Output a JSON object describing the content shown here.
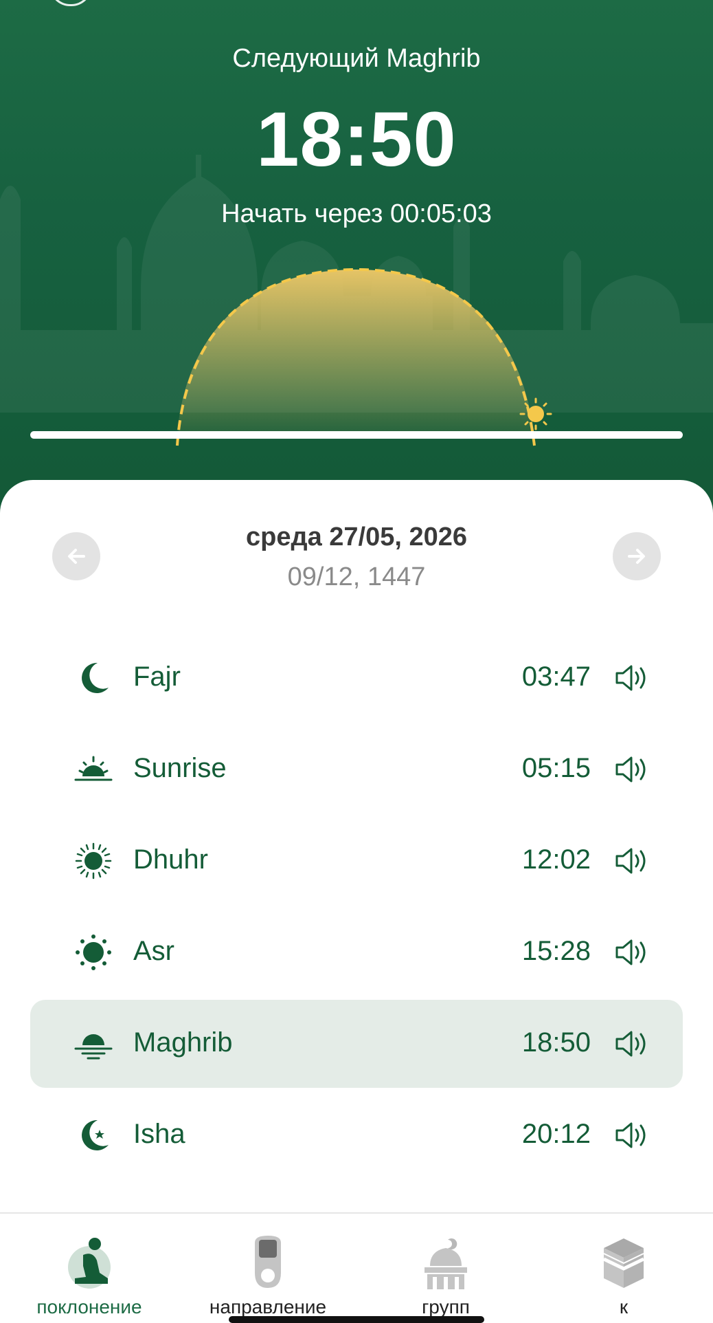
{
  "header": {
    "next_label": "Следующий Maghrib",
    "next_time": "18:50",
    "countdown": "Начать через 00:05:03"
  },
  "date": {
    "gregorian": "среда 27/05,  2026",
    "hijri": "09/12, 1447"
  },
  "prayers": [
    {
      "name": "Fajr",
      "time": "03:47",
      "icon": "crescent-moon-icon",
      "active": false
    },
    {
      "name": "Sunrise",
      "time": "05:15",
      "icon": "sunrise-icon",
      "active": false
    },
    {
      "name": "Dhuhr",
      "time": "12:02",
      "icon": "sun-rays-icon",
      "active": false
    },
    {
      "name": "Asr",
      "time": "15:28",
      "icon": "sun-dots-icon",
      "active": false
    },
    {
      "name": "Maghrib",
      "time": "18:50",
      "icon": "sunset-icon",
      "active": true
    },
    {
      "name": "Isha",
      "time": "20:12",
      "icon": "moon-star-icon",
      "active": false
    }
  ],
  "tabs": [
    {
      "label": "поклонение",
      "icon": "prayer-person-icon",
      "active": true
    },
    {
      "label": "направление",
      "icon": "tasbih-counter-icon",
      "active": false
    },
    {
      "label": "групп",
      "icon": "mosque-icon",
      "active": false
    },
    {
      "label": "к",
      "icon": "kaaba-icon",
      "active": false
    }
  ],
  "colors": {
    "primary": "#1d6b45",
    "text_green": "#145c37",
    "active_row": "#e4ece7",
    "sun": "#f4c84b"
  }
}
